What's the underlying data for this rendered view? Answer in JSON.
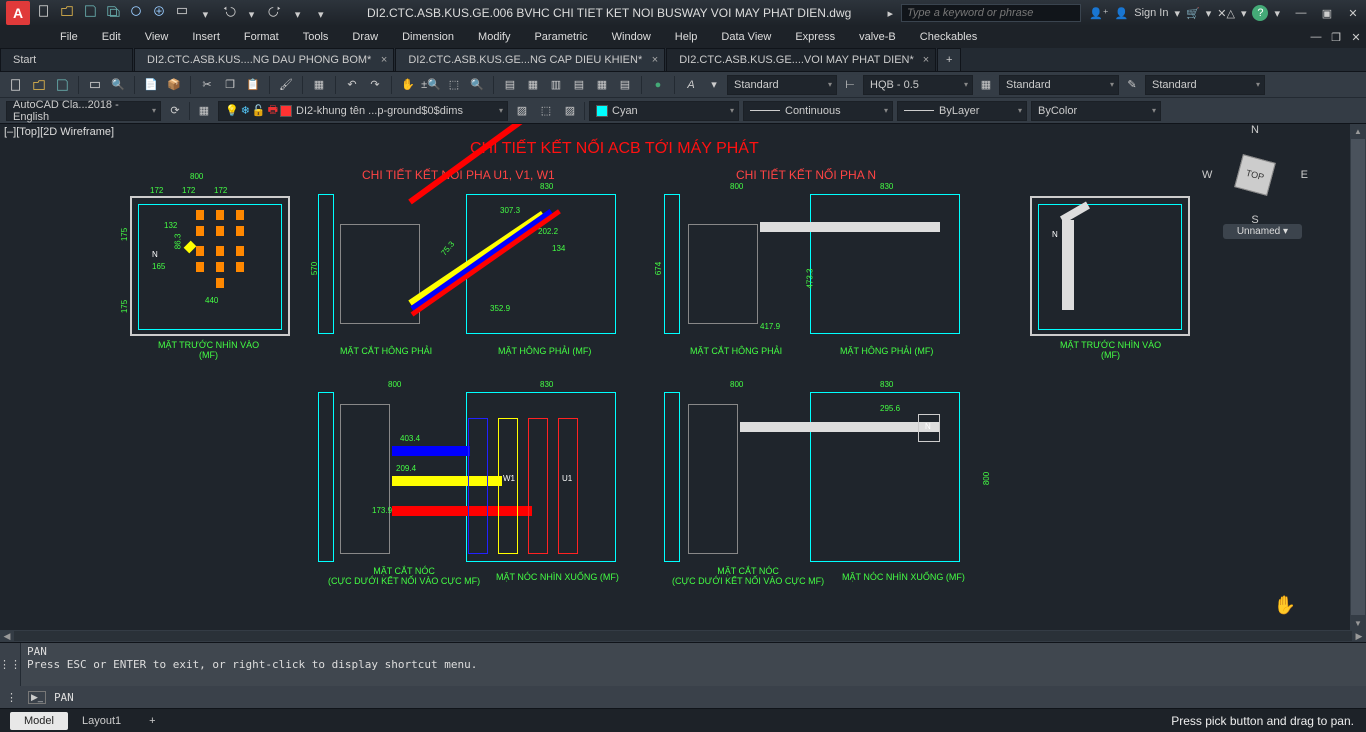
{
  "title_filename": "DI2.CTC.ASB.KUS.GE.006 BVHC CHI TIET KET NOI BUSWAY VOI MAY PHAT DIEN.dwg",
  "search_placeholder": "Type a keyword or phrase",
  "signin": "Sign In",
  "menus": [
    "File",
    "Edit",
    "View",
    "Insert",
    "Format",
    "Tools",
    "Draw",
    "Dimension",
    "Modify",
    "Parametric",
    "Window",
    "Help",
    "Data View",
    "Express",
    "valve-B",
    "Checkables"
  ],
  "tabs": {
    "start": "Start",
    "items": [
      {
        "label": "DI2.CTC.ASB.KUS....NG DAU PHONG BOM*"
      },
      {
        "label": "DI2.CTC.ASB.KUS.GE...NG CAP DIEU KHIEN*"
      },
      {
        "label": "DI2.CTC.ASB.KUS.GE....VOI MAY PHAT DIEN*",
        "active": true
      }
    ]
  },
  "ribbonA": {
    "textstyle": "Standard",
    "dimstyle": "HQB - 0.5",
    "tablestyle": "Standard",
    "mlstyle": "Standard"
  },
  "ribbonB": {
    "layer_style": "AutoCAD Cla...2018 - English",
    "layer": "DI2-khung tên ...p-ground$0$dims",
    "color": "Cyan",
    "linetype": "Continuous",
    "lineweight": "ByLayer",
    "plotstyle": "ByColor"
  },
  "viewport_label": "[–][Top][2D Wireframe]",
  "nav": {
    "top": "TOP",
    "n": "N",
    "s": "S",
    "e": "E",
    "w": "W",
    "unnamed": "Unnamed"
  },
  "drawing": {
    "main_title": "CHI TIẾT KẾT NỐI ACB TỚI MÁY PHÁT",
    "sub1": "CHI TIẾT KẾT NỐI PHA U1, V1, W1",
    "sub2": "CHI TIẾT KẾT NỐI PHA N",
    "lbl_mt": "MẶT TRƯỚC NHÌN VÀO\n(MF)",
    "lbl_mchp": "MẶT CẮT HÔNG PHẢI",
    "lbl_mhp": "MẶT HÔNG PHẢI (MF)",
    "lbl_mcn": "MẶT CẮT NÓC\n(CỰC DƯỚI KẾT NỐI VÀO CỰC MF)",
    "lbl_mnnx": "MẶT NÓC NHÌN XUỐNG (MF)",
    "dim_800": "800",
    "dim_172": "172",
    "dim_175": "175",
    "dim_165": "165",
    "dim_440": "440",
    "dim_132": "132",
    "dim_863": "86.3",
    "dim_830": "830",
    "dim_570": "570",
    "dim_307": "307.3",
    "dim_202": "202.2",
    "dim_134": "134",
    "dim_352": "352.9",
    "dim_753": "75.3",
    "dim_674": "674",
    "dim_473": "473.3",
    "dim_417": "417.9",
    "dim_295": "295.6",
    "dim_173": "173.9",
    "dim_209": "209.4",
    "dim_403": "403.4",
    "tag_w1": "W1",
    "tag_u1": "U1",
    "tag_n": "N"
  },
  "cmd": {
    "hist1": "PAN",
    "hist2": "Press ESC or ENTER to exit, or right-click to display shortcut menu.",
    "prompt": "PAN"
  },
  "bottom": {
    "model": "Model",
    "layout": "Layout1",
    "status": "Press pick button and drag to pan."
  }
}
